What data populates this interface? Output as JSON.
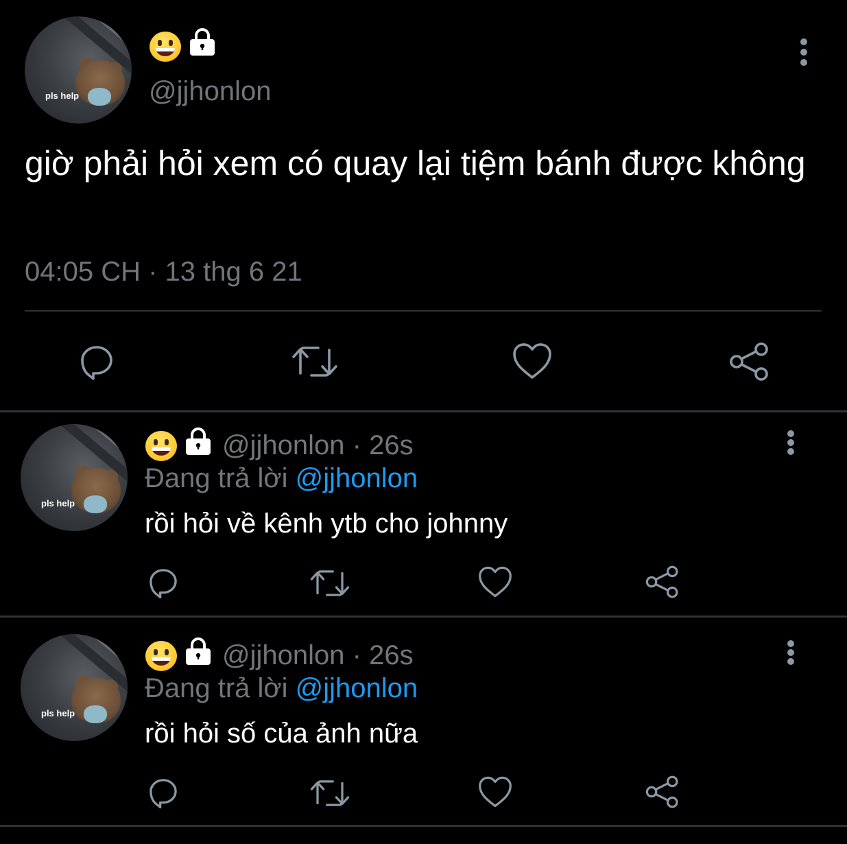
{
  "main_tweet": {
    "avatar_text": "pls help",
    "username": "@jjhonlon",
    "text": "giờ phải hỏi xem có quay lại tiệm bánh được không",
    "timestamp": "04:05 CH · 13 thg 6 21",
    "icons": {
      "name_emoji": "grinning-face-emoji",
      "name_badge": "lock-icon",
      "menu": "more-vertical-icon",
      "actions": [
        "reply-icon",
        "retweet-icon",
        "like-icon",
        "share-icon"
      ]
    }
  },
  "replies": [
    {
      "avatar_text": "pls help",
      "username": "@jjhonlon",
      "separator": "·",
      "time": "26s",
      "replying_label": "Đang trả lời",
      "replying_to": "@jjhonlon",
      "text": "rồi hỏi về kênh ytb cho johnny"
    },
    {
      "avatar_text": "pls help",
      "username": "@jjhonlon",
      "separator": "·",
      "time": "26s",
      "replying_label": "Đang trả lời",
      "replying_to": "@jjhonlon",
      "text": "rồi hỏi số của ảnh nữa"
    }
  ],
  "colors": {
    "background": "#000000",
    "text": "#e7e9ea",
    "muted": "#71767b",
    "link": "#1d9bf0",
    "icon": "#8b98a5",
    "divider": "#2f3336"
  }
}
